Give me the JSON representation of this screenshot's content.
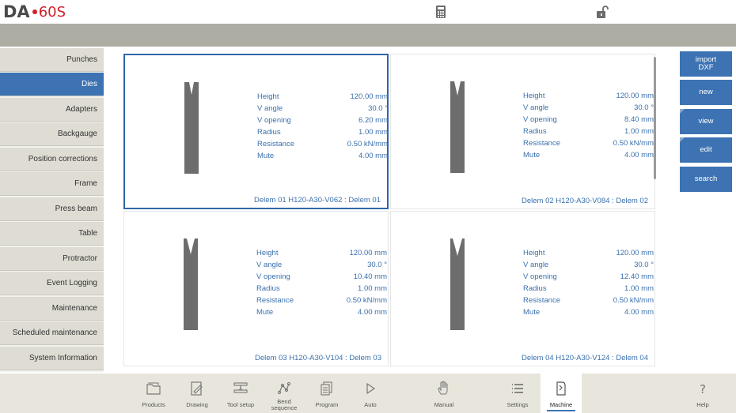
{
  "header": {
    "logo_brand": "DA",
    "logo_model": "60S",
    "icons": [
      "calculator-icon",
      "unlocked-padlock-icon"
    ]
  },
  "sidebar": {
    "items": [
      {
        "label": "Punches",
        "active": false
      },
      {
        "label": "Dies",
        "active": true
      },
      {
        "label": "Adapters",
        "active": false
      },
      {
        "label": "Backgauge",
        "active": false
      },
      {
        "label": "Position corrections",
        "active": false
      },
      {
        "label": "Frame",
        "active": false
      },
      {
        "label": "Press beam",
        "active": false
      },
      {
        "label": "Table",
        "active": false
      },
      {
        "label": "Protractor",
        "active": false
      },
      {
        "label": "Event Logging",
        "active": false
      },
      {
        "label": "Maintenance",
        "active": false
      },
      {
        "label": "Scheduled maintenance",
        "active": false
      },
      {
        "label": "System Information",
        "active": false
      }
    ]
  },
  "dies": [
    {
      "name": "Delem 01 H120-A30-V062 : Delem 01",
      "selected": true,
      "props": [
        {
          "label": "Height",
          "value": "120.00 mm"
        },
        {
          "label": "V angle",
          "value": "30.0 °"
        },
        {
          "label": "V opening",
          "value": "6.20 mm"
        },
        {
          "label": "Radius",
          "value": "1.00 mm"
        },
        {
          "label": "Resistance",
          "value": "0.50 kN/mm"
        },
        {
          "label": "Mute",
          "value": "4.00 mm"
        }
      ]
    },
    {
      "name": "Delem 02 H120-A30-V084 : Delem 02",
      "selected": false,
      "props": [
        {
          "label": "Height",
          "value": "120.00 mm"
        },
        {
          "label": "V angle",
          "value": "30.0 °"
        },
        {
          "label": "V opening",
          "value": "8.40 mm"
        },
        {
          "label": "Radius",
          "value": "1.00 mm"
        },
        {
          "label": "Resistance",
          "value": "0.50 kN/mm"
        },
        {
          "label": "Mute",
          "value": "4.00 mm"
        }
      ]
    },
    {
      "name": "Delem 03 H120-A30-V104 : Delem 03",
      "selected": false,
      "props": [
        {
          "label": "Height",
          "value": "120.00 mm"
        },
        {
          "label": "V angle",
          "value": "30.0 °"
        },
        {
          "label": "V opening",
          "value": "10.40 mm"
        },
        {
          "label": "Radius",
          "value": "1.00 mm"
        },
        {
          "label": "Resistance",
          "value": "0.50 kN/mm"
        },
        {
          "label": "Mute",
          "value": "4.00 mm"
        }
      ]
    },
    {
      "name": "Delem 04 H120-A30-V124 : Delem 04",
      "selected": false,
      "props": [
        {
          "label": "Height",
          "value": "120.00 mm"
        },
        {
          "label": "V angle",
          "value": "30.0 °"
        },
        {
          "label": "V opening",
          "value": "12.40 mm"
        },
        {
          "label": "Radius",
          "value": "1.00 mm"
        },
        {
          "label": "Resistance",
          "value": "0.50 kN/mm"
        },
        {
          "label": "Mute",
          "value": "4.00 mm"
        }
      ]
    }
  ],
  "actions": {
    "import_line1": "import",
    "import_line2": "DXF",
    "new": "new",
    "view": "view",
    "edit": "edit",
    "search": "search"
  },
  "bottom_nav": [
    {
      "label": "Products",
      "icon": "folder-icon"
    },
    {
      "label": "Drawing",
      "icon": "pencil-drawing-icon"
    },
    {
      "label": "Tool setup",
      "icon": "tool-setup-icon"
    },
    {
      "label": "Bend sequence",
      "icon": "bend-sequence-icon"
    },
    {
      "label": "Program",
      "icon": "pages-icon"
    },
    {
      "label": "Auto",
      "icon": "play-icon"
    },
    {
      "label": "Manual",
      "icon": "hand-icon"
    },
    {
      "label": "Settings",
      "icon": "list-icon"
    },
    {
      "label": "Machine",
      "icon": "machine-icon",
      "active": true
    },
    {
      "label": "Help",
      "icon": "question-icon"
    }
  ],
  "colors": {
    "accent": "#3d73b3",
    "brand_red": "#d0202a",
    "sidebar_bg": "#dedcd3",
    "toolbar_bg": "#e8e6dc",
    "header_band": "#aeada3"
  }
}
